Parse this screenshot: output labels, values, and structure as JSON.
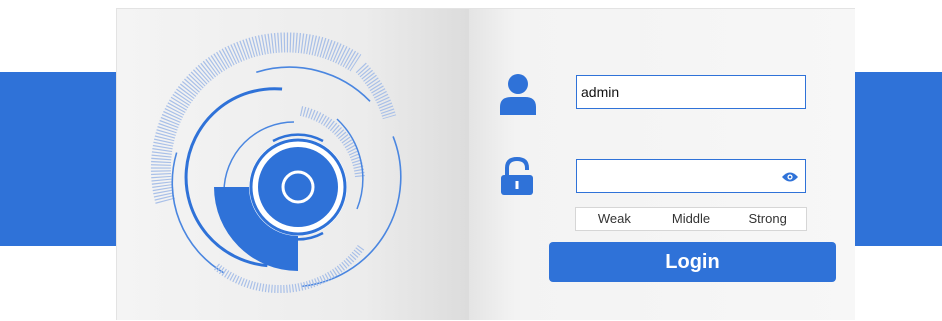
{
  "colors": {
    "accent": "#2f72d8",
    "card_background": "#f6f6f6",
    "page_background": "#ffffff"
  },
  "icons": {
    "user": "user-icon",
    "lock": "unlock-icon",
    "eye": "eye-icon",
    "logo": "radar-logo"
  },
  "login_form": {
    "username": {
      "value": "admin",
      "placeholder": ""
    },
    "password": {
      "value": "",
      "placeholder": ""
    },
    "strength_labels": {
      "weak": "Weak",
      "middle": "Middle",
      "strong": "Strong"
    },
    "login_label": "Login"
  }
}
